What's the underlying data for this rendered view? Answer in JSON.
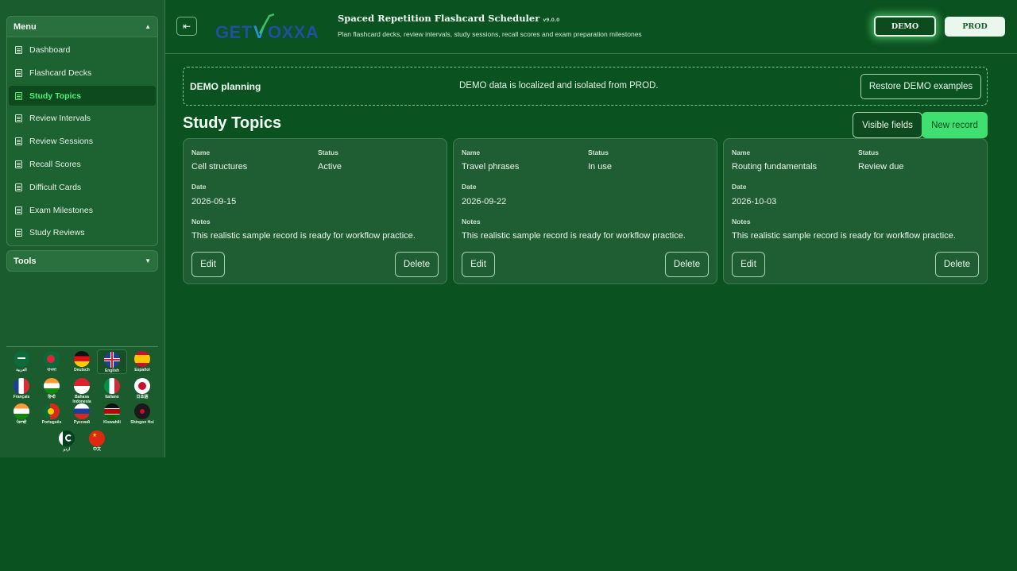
{
  "sidebar": {
    "menu_title": "Menu",
    "items": [
      {
        "label": "Dashboard",
        "active": false
      },
      {
        "label": "Flashcard Decks",
        "active": false
      },
      {
        "label": "Study Topics",
        "active": true
      },
      {
        "label": "Review Intervals",
        "active": false
      },
      {
        "label": "Review Sessions",
        "active": false
      },
      {
        "label": "Recall Scores",
        "active": false
      },
      {
        "label": "Difficult Cards",
        "active": false
      },
      {
        "label": "Exam Milestones",
        "active": false
      },
      {
        "label": "Study Reviews",
        "active": false
      }
    ],
    "tools_title": "Tools",
    "languages": [
      {
        "label": "العربية",
        "icon": "flag-saudi-arabia"
      },
      {
        "label": "বাংলা",
        "icon": "flag-bangladesh"
      },
      {
        "label": "Deutsch",
        "icon": "flag-germany"
      },
      {
        "label": "English",
        "icon": "flag-uk",
        "selected": true
      },
      {
        "label": "Español",
        "icon": "flag-spain"
      },
      {
        "label": "Français",
        "icon": "flag-france"
      },
      {
        "label": "हिन्दी",
        "icon": "flag-india"
      },
      {
        "label": "Bahasa Indonesia",
        "icon": "flag-indonesia"
      },
      {
        "label": "Italiano",
        "icon": "flag-italy"
      },
      {
        "label": "日本語",
        "icon": "flag-japan"
      },
      {
        "label": "ਪੰਜਾਬੀ",
        "icon": "flag-india"
      },
      {
        "label": "Português",
        "icon": "flag-portugal"
      },
      {
        "label": "Русский",
        "icon": "flag-russia"
      },
      {
        "label": "Kiswahili",
        "icon": "flag-kenya"
      },
      {
        "label": "Shingon Hoi",
        "icon": "flag-emblem"
      },
      {
        "label": "اردو",
        "icon": "flag-pakistan"
      },
      {
        "label": "中文",
        "icon": "flag-china"
      }
    ]
  },
  "header": {
    "logo_text": "GETVOXXA",
    "title": "Spaced Repetition Flashcard Scheduler",
    "version": "v9.0.0",
    "subtitle": "Plan flashcard decks, review intervals, study sessions, recall scores and exam preparation milestones",
    "demo_label": "DEMO",
    "prod_label": "PROD"
  },
  "banner": {
    "title": "DEMO planning",
    "message": "DEMO data is localized and isolated from PROD.",
    "restore_label": "Restore DEMO examples"
  },
  "main": {
    "section_title": "Study Topics",
    "visible_fields_label": "Visible fields",
    "new_record_label": "New record",
    "field_labels": {
      "name": "Name",
      "status": "Status",
      "date": "Date",
      "notes": "Notes"
    },
    "edit_label": "Edit",
    "delete_label": "Delete",
    "records": [
      {
        "name": "Cell structures",
        "status": "Active",
        "date": "2026-09-15",
        "notes": "This realistic sample record is ready for workflow practice."
      },
      {
        "name": "Travel phrases",
        "status": "In use",
        "date": "2026-09-22",
        "notes": "This realistic sample record is ready for workflow practice."
      },
      {
        "name": "Routing fundamentals",
        "status": "Review due",
        "date": "2026-10-03",
        "notes": "This realistic sample record is ready for workflow practice."
      }
    ]
  },
  "colors": {
    "background": "#0a5220",
    "sidebar": "#1a5c2e",
    "accent": "#3fe070",
    "active_text": "#4ef07a"
  }
}
